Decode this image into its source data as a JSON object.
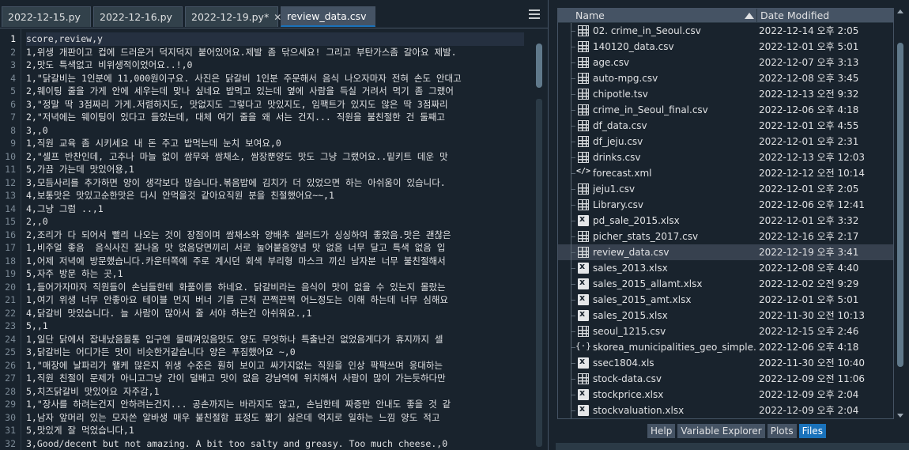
{
  "editor": {
    "tabs": [
      {
        "label": "2022-12-15.py",
        "active": false
      },
      {
        "label": "2022-12-16.py",
        "active": false
      },
      {
        "label": "2022-12-19.py*",
        "active": false
      },
      {
        "label": "review_data.csv",
        "active": true
      }
    ],
    "current_line": 1,
    "lines": [
      "score,review,y",
      "1,위생 개판이고 컵에 드러운거 덕지덕지 붙어있어요.제발 좀 닦으세요! 그리고 부탄가스좀 갈아요 제발.",
      "2,맛도 특색없고 비위생적이었어요..!,0",
      "1,\"닭갈비는 1인분에 11,000원이구요. 사진은 닭갈비 1인분 주문해서 음식 나오자마자 전혀 손도 안대고",
      "2,웨이팅 줄을 가게 안에 세우는데 맞나 싶네요 밥먹고 있는데 옆에 사람을 득실 거려서 먹기 좀 그랬어",
      "3,\"정말 딱 3점짜리 가게.저렴하지도, 맛없지도 그렇다고 맛있지도, 임팩트가 있지도 않은 딱 3점짜리",
      "2,\"저녁에는 웨이팅이 있다고 들었는데, 대체 여기 줄을 왜 서는 건지... 직원을 불친절한 건 둘째고",
      "3,,0",
      "1,직원 교육 좀 시키세요 내 돈 주고 밥먹는데 눈치 보여요,0",
      "2,\"셀프 반찬인데, 고추나 마늘 없이 쌈무와 쌈채소, 쌈장뿐양도 맛도 그냥 그랬어요..밑키트 데운 맛",
      "5,가끔 가는데 맛있어용,1",
      "3,모듬사리를 추가하면 양이 생각보다 많습니다.볶음밥에 김치가 더 있었으면 하는 아쉬움이 있습니다.",
      "4,보통맛은 맛있고순한맛은 다시 안먹을것 같아요직원 분을 친절했어요~~,1",
      "4,그냥 그럼 ..,1",
      "2,,0",
      "2,조리가 다 되어서 빨리 나오는 것이 장점이며 쌈채소와 양배추 샐러드가 싱싱하여 좋았음.맛은 괜찮은",
      "1,비주얼 좋음  음식사진 잘나옴 맛 없음당면끼리 서로 눌어붙음양념 맛 없음 너무 달고 특색 없음 입",
      "1,어제 저녁에 방문했습니다.카운터쪽에 주로 계시던 회색 부리형 마스크 끼신 남자분 너무 불친절해서",
      "5,자주 방문 하는 곳,1",
      "1,들어가자마자 직원들이 손님들한테 화풀이를 하네요. 닭갈비라는 음식이 맛이 없을 수 있는지 몰랐는",
      "1,여기 위생 너무 안좋아요 테이블 먼지 버너 기름 근처 끈쩍끈쩍 어느정도는 이해 하는데 너무 심해요",
      "4,닭갈비 맛있습니다. 늘 사람이 많아서 줄 서야 하는건 아쉬워요.,1",
      "5,,1",
      "1,일단 닭에서 잡내났음물통 입구엔 물때껴있음맛도 양도 무엇하나 특출난건 없었음게다가 휴지까지 셀",
      "3,닭갈비는 어디가든 맛이 비슷한거같습니다 양은 푸짐했어요 ~,0",
      "1,\"매장에 날파리가 왤케 많은지 위생 수준은 훤히 보이고 싸가지없는 직원을 인상 팍팍쓰며 응대하는",
      "1,직원 친절이 문제가 아니고그냥 간이 덜배고 맛이 없음 강남역에 위치해서 사람이 많이 가는듯하다만",
      "5,치즈닭갈비 맛있어요 자주감,1",
      "1,\"장사를 하려는건지 안하려는건지... 공손까지는 바라지도 않고, 손님한테 짜증만 안내도 좋을 것 같",
      "1,남자 앞머리 있는 모자쓴 알바생 매우 불친절함 표정도 짧기 싫은데 억지로 일하는 느낌 양도 적고",
      "5,맛있게 잘 먹었습니다,1",
      "3,Good/decent but not amazing. A bit too salty and greasy. Too much cheese.,0"
    ]
  },
  "files": {
    "columns": {
      "name": "Name",
      "date": "Date Modified"
    },
    "rows": [
      {
        "name": "02. crime_in_Seoul.csv",
        "date": "2022-12-14 오후 2:05",
        "icon": "table-icon"
      },
      {
        "name": "140120_data.csv",
        "date": "2022-12-01 오후 5:01",
        "icon": "table-icon"
      },
      {
        "name": "age.csv",
        "date": "2022-12-07 오후 3:13",
        "icon": "table-icon"
      },
      {
        "name": "auto-mpg.csv",
        "date": "2022-12-08 오후 3:45",
        "icon": "table-icon"
      },
      {
        "name": "chipotle.tsv",
        "date": "2022-12-13 오전 9:32",
        "icon": "table-icon"
      },
      {
        "name": "crime_in_Seoul_final.csv",
        "date": "2022-12-06 오후 4:18",
        "icon": "table-icon"
      },
      {
        "name": "df_data.csv",
        "date": "2022-12-01 오후 4:55",
        "icon": "table-icon"
      },
      {
        "name": "df_jeju.csv",
        "date": "2022-12-01 오후 2:31",
        "icon": "table-icon"
      },
      {
        "name": "drinks.csv",
        "date": "2022-12-13 오후 12:03",
        "icon": "table-icon"
      },
      {
        "name": "forecast.xml",
        "date": "2022-12-12 오전 10:14",
        "icon": "code-icon"
      },
      {
        "name": "jeju1.csv",
        "date": "2022-12-01 오후 2:05",
        "icon": "table-icon"
      },
      {
        "name": "Library.csv",
        "date": "2022-12-06 오후 12:41",
        "icon": "table-icon"
      },
      {
        "name": "pd_sale_2015.xlsx",
        "date": "2022-12-01 오후 3:32",
        "icon": "excel-icon"
      },
      {
        "name": "picher_stats_2017.csv",
        "date": "2022-12-16 오후 2:17",
        "icon": "table-icon"
      },
      {
        "name": "review_data.csv",
        "date": "2022-12-19 오후 3:41",
        "icon": "table-icon",
        "selected": true
      },
      {
        "name": "sales_2013.xlsx",
        "date": "2022-12-08 오후 4:40",
        "icon": "excel-icon"
      },
      {
        "name": "sales_2015_allamt.xlsx",
        "date": "2022-12-02 오전 9:29",
        "icon": "excel-icon"
      },
      {
        "name": "sales_2015_amt.xlsx",
        "date": "2022-12-01 오후 5:01",
        "icon": "excel-icon"
      },
      {
        "name": "sales_2015.xlsx",
        "date": "2022-11-30 오전 10:13",
        "icon": "excel-icon"
      },
      {
        "name": "seoul_1215.csv",
        "date": "2022-12-15 오후 2:46",
        "icon": "table-icon"
      },
      {
        "name": "skorea_municipalities_geo_simple.json",
        "date": "2022-12-06 오후 4:18",
        "icon": "json-icon"
      },
      {
        "name": "ssec1804.xls",
        "date": "2022-11-30 오전 10:40",
        "icon": "excel-icon"
      },
      {
        "name": "stock-data.csv",
        "date": "2022-12-09 오전 11:06",
        "icon": "table-icon"
      },
      {
        "name": "stockprice.xlsx",
        "date": "2022-12-09 오후 2:04",
        "icon": "excel-icon"
      },
      {
        "name": "stockvaluation.xlsx",
        "date": "2022-12-09 오후 2:04",
        "icon": "excel-icon"
      }
    ]
  },
  "bottom_tabs": [
    {
      "label": "Help",
      "active": false
    },
    {
      "label": "Variable Explorer",
      "active": false
    },
    {
      "label": "Plots",
      "active": false
    },
    {
      "label": "Files",
      "active": true
    }
  ],
  "colors": {
    "accent": "#1a72bb",
    "background": "#19232d",
    "panel": "#455364"
  }
}
